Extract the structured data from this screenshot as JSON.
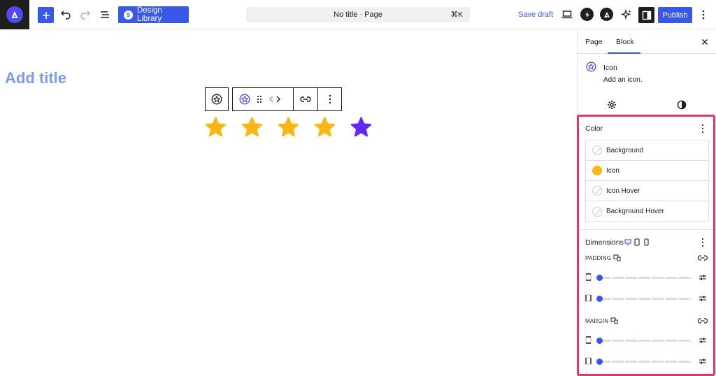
{
  "topbar": {
    "design_library_label": "Design Library",
    "doc_title": "No title · Page",
    "shortcut": "⌘K",
    "save_draft_label": "Save draft",
    "publish_label": "Publish"
  },
  "canvas": {
    "title_placeholder": "Add title",
    "stars": [
      {
        "color": "#f8b714"
      },
      {
        "color": "#f8b714"
      },
      {
        "color": "#f8b714"
      },
      {
        "color": "#f8b714"
      },
      {
        "color": "#6429f0"
      }
    ]
  },
  "sidebar": {
    "tabs": [
      "Page",
      "Block"
    ],
    "block_name": "Icon",
    "block_description": "Add an icon.",
    "color_panel": {
      "title": "Color",
      "items": [
        {
          "label": "Background",
          "swatch": "none"
        },
        {
          "label": "Icon",
          "swatch": "#f8b714"
        },
        {
          "label": "Icon Hover",
          "swatch": "none"
        },
        {
          "label": "Background Hover",
          "swatch": "none"
        }
      ]
    },
    "dimensions_panel": {
      "title": "Dimensions",
      "padding_label": "PADDING",
      "margin_label": "MARGIN"
    }
  },
  "colors": {
    "accent": "#3858e9",
    "highlight": "#e8336b"
  }
}
